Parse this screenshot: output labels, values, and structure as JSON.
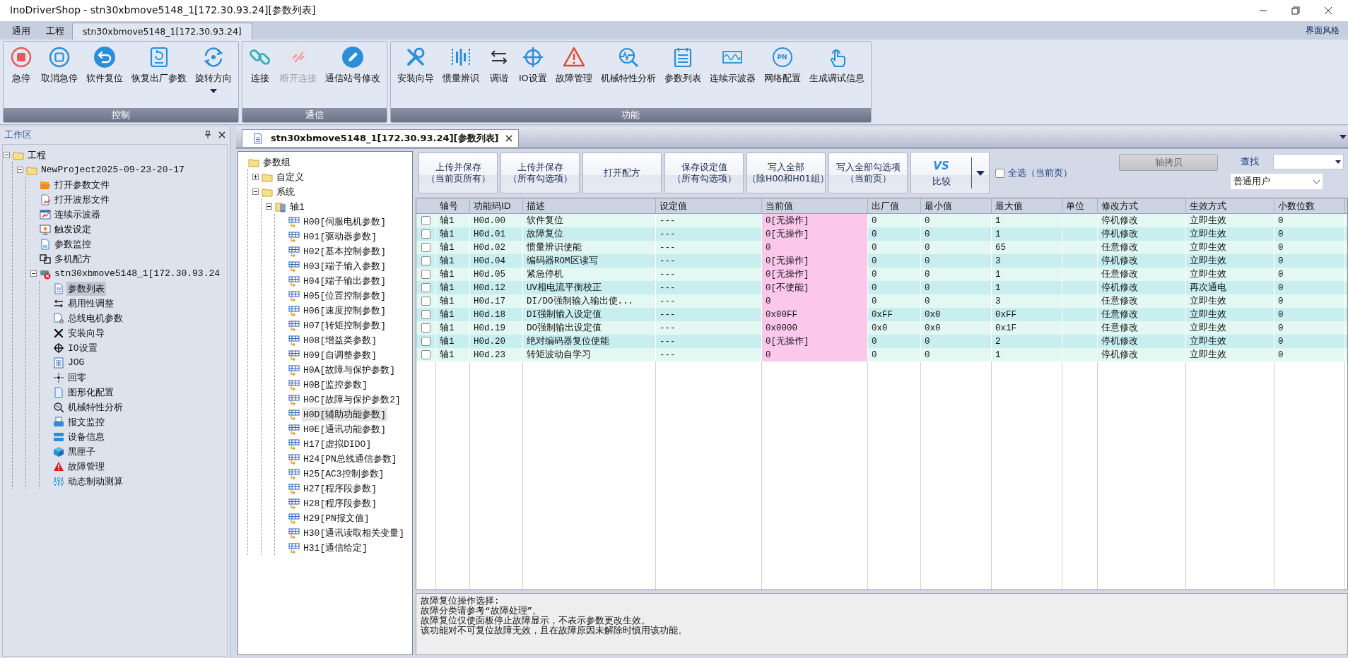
{
  "window": {
    "title": "InoDriverShop - stn30xbmove5148_1[172.30.93.24][参数列表]"
  },
  "menu_tabs": [
    {
      "label": "通用",
      "selected": false
    },
    {
      "label": "工程",
      "selected": false
    },
    {
      "label": "stn30xbmove5148_1[172.30.93.24]",
      "selected": true
    }
  ],
  "menu_right": "界面风格",
  "ribbon_groups": [
    {
      "label": "控制",
      "tools": [
        {
          "label": "急停",
          "disabled": false
        },
        {
          "label": "取消急停",
          "disabled": false
        },
        {
          "label": "软件复位",
          "disabled": false
        },
        {
          "label": "恢复出厂参数",
          "disabled": false
        },
        {
          "label": "旋转方向",
          "disabled": false
        }
      ]
    },
    {
      "label": "通信",
      "tools": [
        {
          "label": "连接",
          "disabled": false
        },
        {
          "label": "断开连接",
          "disabled": true
        },
        {
          "label": "通信站号修改",
          "disabled": false
        }
      ]
    },
    {
      "label": "功能",
      "tools": [
        {
          "label": "安装向导",
          "disabled": false
        },
        {
          "label": "惯量辨识",
          "disabled": false
        },
        {
          "label": "调谐",
          "disabled": false
        },
        {
          "label": "IO设置",
          "disabled": false
        },
        {
          "label": "故障管理",
          "disabled": false
        },
        {
          "label": "机械特性分析",
          "disabled": false
        },
        {
          "label": "参数列表",
          "disabled": false
        },
        {
          "label": "连续示波器",
          "disabled": false
        },
        {
          "label": "网络配置",
          "disabled": false,
          "badge": "PN"
        },
        {
          "label": "生成调试信息",
          "disabled": false
        }
      ]
    }
  ],
  "workspace": {
    "title": "工作区",
    "tree": [
      {
        "label": "工程",
        "selected": false,
        "expanded": true,
        "children": [
          {
            "label": "NewProject2025-09-23-20-17",
            "selected": false,
            "expanded": true,
            "children": [
              {
                "label": "打开参数文件",
                "selected": false
              },
              {
                "label": "打开波形文件",
                "selected": false
              },
              {
                "label": "连续示波器",
                "selected": false
              },
              {
                "label": "触发设定",
                "selected": false
              },
              {
                "label": "参数监控",
                "selected": false
              },
              {
                "label": "多机配方",
                "selected": false
              },
              {
                "label": "stn30xbmove5148_1[172.30.93.24",
                "selected": false,
                "expanded": true,
                "children": [
                  {
                    "label": "参数列表",
                    "selected": true
                  },
                  {
                    "label": "易用性调整",
                    "selected": false
                  },
                  {
                    "label": "总线电机参数",
                    "selected": false
                  },
                  {
                    "label": "安装向导",
                    "selected": false
                  },
                  {
                    "label": "IO设置",
                    "selected": false
                  },
                  {
                    "label": "JOG",
                    "selected": false
                  },
                  {
                    "label": "回零",
                    "selected": false
                  },
                  {
                    "label": "图形化配置",
                    "selected": false
                  },
                  {
                    "label": "机械特性分析",
                    "selected": false
                  },
                  {
                    "label": "报文监控",
                    "selected": false
                  },
                  {
                    "label": "设备信息",
                    "selected": false
                  },
                  {
                    "label": "黑匣子",
                    "selected": false
                  },
                  {
                    "label": "故障管理",
                    "selected": false
                  },
                  {
                    "label": "动态制动测算",
                    "selected": false
                  }
                ]
              }
            ]
          }
        ]
      }
    ]
  },
  "document_tab": {
    "title": "stn30xbmove5148_1[172.30.93.24][参数列表]"
  },
  "param_groups": {
    "tree": [
      {
        "label": "参数组",
        "selected": false,
        "children": [
          {
            "label": "自定义",
            "selected": false,
            "expanded": false
          },
          {
            "label": "系统",
            "selected": false,
            "expanded": true,
            "children": [
              {
                "label": "轴1",
                "selected": false,
                "expanded": true,
                "children": [
                  {
                    "label": "H00[伺服电机参数]",
                    "selected": false
                  },
                  {
                    "label": "H01[驱动器参数]",
                    "selected": false
                  },
                  {
                    "label": "H02[基本控制参数]",
                    "selected": false
                  },
                  {
                    "label": "H03[端子输入参数]",
                    "selected": false
                  },
                  {
                    "label": "H04[端子输出参数]",
                    "selected": false
                  },
                  {
                    "label": "H05[位置控制参数]",
                    "selected": false
                  },
                  {
                    "label": "H06[速度控制参数]",
                    "selected": false
                  },
                  {
                    "label": "H07[转矩控制参数]",
                    "selected": false
                  },
                  {
                    "label": "H08[增益类参数]",
                    "selected": false
                  },
                  {
                    "label": "H09[自调整参数]",
                    "selected": false
                  },
                  {
                    "label": "H0A[故障与保护参数]",
                    "selected": false
                  },
                  {
                    "label": "H0B[监控参数]",
                    "selected": false
                  },
                  {
                    "label": "H0C[故障与保护参数2]",
                    "selected": false
                  },
                  {
                    "label": "H0D[辅助功能参数]",
                    "selected": true
                  },
                  {
                    "label": "H0E[通讯功能参数]",
                    "selected": false
                  },
                  {
                    "label": "H17[虚拟DIDO]",
                    "selected": false
                  },
                  {
                    "label": "H24[PN总线通信参数]",
                    "selected": false
                  },
                  {
                    "label": "H25[AC3控制参数]",
                    "selected": false
                  },
                  {
                    "label": "H27[程序段参数]",
                    "selected": false
                  },
                  {
                    "label": "H28[程序段参数]",
                    "selected": false
                  },
                  {
                    "label": "H29[PN报文值]",
                    "selected": false
                  },
                  {
                    "label": "H30[通讯读取相关变量]",
                    "selected": false
                  },
                  {
                    "label": "H31[通信给定]",
                    "selected": false
                  }
                ]
              }
            ]
          }
        ]
      }
    ]
  },
  "actions": [
    {
      "lines": [
        "上传并保存",
        "（当前页所有）"
      ]
    },
    {
      "lines": [
        "上传并保存",
        "（所有勾选项）"
      ]
    },
    {
      "lines": [
        "打开配方"
      ]
    },
    {
      "lines": [
        "保存设定值",
        "（所有勾选项）"
      ]
    },
    {
      "lines": [
        "写入全部",
        "（除H00和H01組）"
      ]
    },
    {
      "lines": [
        "写入全部勾选项",
        "（当前页）"
      ]
    }
  ],
  "compare": {
    "badge": "VS",
    "label": "比较"
  },
  "select_all": {
    "label": "全选（当前页）",
    "checked": false
  },
  "axis_copy": {
    "label": "轴拷贝",
    "disabled": true
  },
  "search": {
    "label": "查找"
  },
  "user_level": {
    "value": "普通用户"
  },
  "table": {
    "columns": [
      "轴号",
      "功能码ID",
      "描述",
      "设定值",
      "当前值",
      "出厂值",
      "最小值",
      "最大值",
      "单位",
      "修改方式",
      "生效方式",
      "小数位数"
    ],
    "rows": [
      {
        "checked": false,
        "axis": "轴1",
        "code": "H0d.00",
        "description": "软件复位",
        "set_value": "---",
        "current_value": "0[无操作]",
        "factory": "0",
        "min": "0",
        "max": "1",
        "modify": "停机修改",
        "effect": "立即生效",
        "decimals": "0"
      },
      {
        "checked": false,
        "axis": "轴1",
        "code": "H0d.01",
        "description": "故障复位",
        "set_value": "---",
        "current_value": "0[无操作]",
        "factory": "0",
        "min": "0",
        "max": "1",
        "modify": "停机修改",
        "effect": "立即生效",
        "decimals": "0"
      },
      {
        "checked": false,
        "axis": "轴1",
        "code": "H0d.02",
        "description": "惯量辨识使能",
        "set_value": "---",
        "current_value": "0",
        "factory": "0",
        "min": "0",
        "max": "65",
        "modify": "任意修改",
        "effect": "立即生效",
        "decimals": "0"
      },
      {
        "checked": false,
        "axis": "轴1",
        "code": "H0d.04",
        "description": "编码器ROM区读写",
        "set_value": "---",
        "current_value": "0[无操作]",
        "factory": "0",
        "min": "0",
        "max": "3",
        "modify": "停机修改",
        "effect": "立即生效",
        "decimals": "0"
      },
      {
        "checked": false,
        "axis": "轴1",
        "code": "H0d.05",
        "description": "紧急停机",
        "set_value": "---",
        "current_value": "0[无操作]",
        "factory": "0",
        "min": "0",
        "max": "1",
        "modify": "任意修改",
        "effect": "立即生效",
        "decimals": "0"
      },
      {
        "checked": false,
        "axis": "轴1",
        "code": "H0d.12",
        "description": "UV相电流平衡校正",
        "set_value": "---",
        "current_value": "0[不使能]",
        "factory": "0",
        "min": "0",
        "max": "1",
        "modify": "停机修改",
        "effect": "再次通电",
        "decimals": "0"
      },
      {
        "checked": false,
        "axis": "轴1",
        "code": "H0d.17",
        "description": "DI/DO强制输入输出使...",
        "set_value": "---",
        "current_value": "0",
        "factory": "0",
        "min": "0",
        "max": "3",
        "modify": "任意修改",
        "effect": "立即生效",
        "decimals": "0"
      },
      {
        "checked": false,
        "axis": "轴1",
        "code": "H0d.18",
        "description": "DI强制输入设定值",
        "set_value": "---",
        "current_value": "0x00FF",
        "factory": "0xFF",
        "min": "0x0",
        "max": "0xFF",
        "modify": "任意修改",
        "effect": "立即生效",
        "decimals": "0"
      },
      {
        "checked": false,
        "axis": "轴1",
        "code": "H0d.19",
        "description": "DO强制输出设定值",
        "set_value": "---",
        "current_value": "0x0000",
        "factory": "0x0",
        "min": "0x0",
        "max": "0x1F",
        "modify": "任意修改",
        "effect": "立即生效",
        "decimals": "0"
      },
      {
        "checked": false,
        "axis": "轴1",
        "code": "H0d.20",
        "description": "绝对编码器复位使能",
        "set_value": "---",
        "current_value": "0[无操作]",
        "factory": "0",
        "min": "0",
        "max": "2",
        "modify": "停机修改",
        "effect": "立即生效",
        "decimals": "0"
      },
      {
        "checked": false,
        "axis": "轴1",
        "code": "H0d.23",
        "description": "转矩波动自学习",
        "set_value": "---",
        "current_value": "0",
        "factory": "0",
        "min": "0",
        "max": "1",
        "modify": "停机修改",
        "effect": "立即生效",
        "decimals": "0"
      }
    ]
  },
  "description": {
    "lines": [
      "故障复位操作选择:",
      "故障分类请参考“故障处理”。",
      "故障复位仅使面板停止故障显示，不表示参数更改生效。",
      "该功能对不可复位故障无效，且在故障原因未解除时慎用该功能。"
    ]
  }
}
